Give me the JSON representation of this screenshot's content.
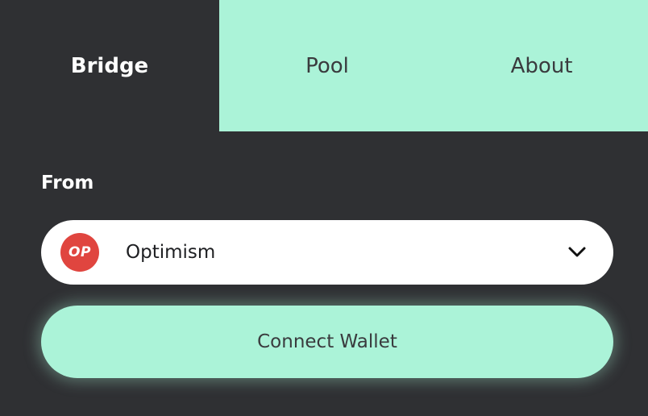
{
  "tabs": [
    {
      "label": "Bridge",
      "active": true
    },
    {
      "label": "Pool",
      "active": false
    },
    {
      "label": "About",
      "active": false
    }
  ],
  "form": {
    "from_label": "From",
    "selected_chain": "Optimism",
    "chain_logo_text": "OP",
    "chain_logo_color": "#e0453f",
    "dropdown_icon": "chevron-down-icon"
  },
  "connect_button_label": "Connect Wallet",
  "colors": {
    "background": "#2f3033",
    "accent": "#abf3d8",
    "select_bg": "#ffffff"
  }
}
